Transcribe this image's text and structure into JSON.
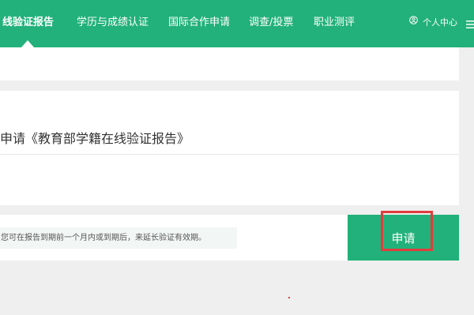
{
  "nav": {
    "items": [
      {
        "label": "线验证报告",
        "active": true
      },
      {
        "label": "学历与成绩认证",
        "active": false
      },
      {
        "label": "国际合作申请",
        "active": false
      },
      {
        "label": "调查/投票",
        "active": false
      },
      {
        "label": "职业测评",
        "active": false
      }
    ],
    "user_center": "个人中心",
    "user_icon": "user-circle-icon",
    "menu_icon": "hamburger-menu-icon"
  },
  "card": {
    "title": "申请《教育部学籍在线验证报告》"
  },
  "note": {
    "text": "您可在报告到期前一个月内或到期后，来延长验证有效期。"
  },
  "apply_button": {
    "label": "申请"
  },
  "colors": {
    "brand": "#22b17a",
    "highlight": "#e23c3c",
    "background": "#efefef"
  }
}
